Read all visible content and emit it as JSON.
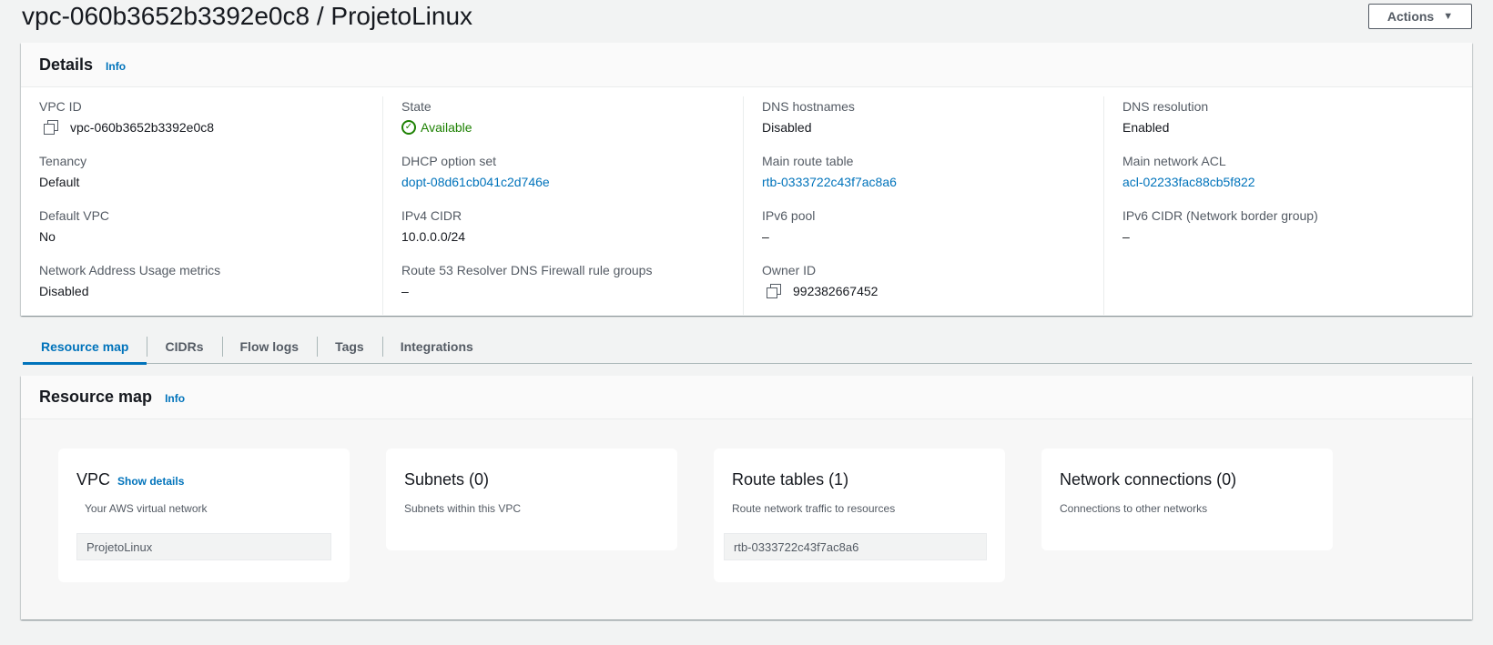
{
  "header": {
    "title": "vpc-060b3652b3392e0c8 / ProjetoLinux",
    "actions_label": "Actions"
  },
  "details": {
    "title": "Details",
    "info": "Info",
    "columns": [
      [
        {
          "label": "VPC ID",
          "value": "vpc-060b3652b3392e0c8"
        },
        {
          "label": "Tenancy",
          "value": "Default"
        },
        {
          "label": "Default VPC",
          "value": "No"
        },
        {
          "label": "Network Address Usage metrics",
          "value": "Disabled"
        }
      ],
      [
        {
          "label": "State",
          "value": "Available"
        },
        {
          "label": "DHCP option set",
          "value": "dopt-08d61cb041c2d746e"
        },
        {
          "label": "IPv4 CIDR",
          "value": "10.0.0.0/24"
        },
        {
          "label": "Route 53 Resolver DNS Firewall rule groups",
          "value": "–"
        }
      ],
      [
        {
          "label": "DNS hostnames",
          "value": "Disabled"
        },
        {
          "label": "Main route table",
          "value": "rtb-0333722c43f7ac8a6"
        },
        {
          "label": "IPv6 pool",
          "value": "–"
        },
        {
          "label": "Owner ID",
          "value": "992382667452"
        }
      ],
      [
        {
          "label": "DNS resolution",
          "value": "Enabled"
        },
        {
          "label": "Main network ACL",
          "value": "acl-02233fac88cb5f822"
        },
        {
          "label": "IPv6 CIDR (Network border group)",
          "value": "–"
        }
      ]
    ]
  },
  "tabs": [
    "Resource map",
    "CIDRs",
    "Flow logs",
    "Tags",
    "Integrations"
  ],
  "resource_map": {
    "title": "Resource map",
    "info": "Info",
    "cards": {
      "vpc": {
        "title": "VPC",
        "link": "Show details",
        "subtitle": "Your AWS virtual network",
        "item": "ProjetoLinux"
      },
      "subnets": {
        "title": "Subnets (0)",
        "subtitle": "Subnets within this VPC"
      },
      "route_tables": {
        "title": "Route tables (1)",
        "subtitle": "Route network traffic to resources",
        "item": "rtb-0333722c43f7ac8a6"
      },
      "network_connections": {
        "title": "Network connections (0)",
        "subtitle": "Connections to other networks"
      }
    }
  },
  "colors": {
    "link": "#0073bb",
    "success": "#1d8102",
    "text": "#16191f",
    "muted": "#545b64"
  }
}
